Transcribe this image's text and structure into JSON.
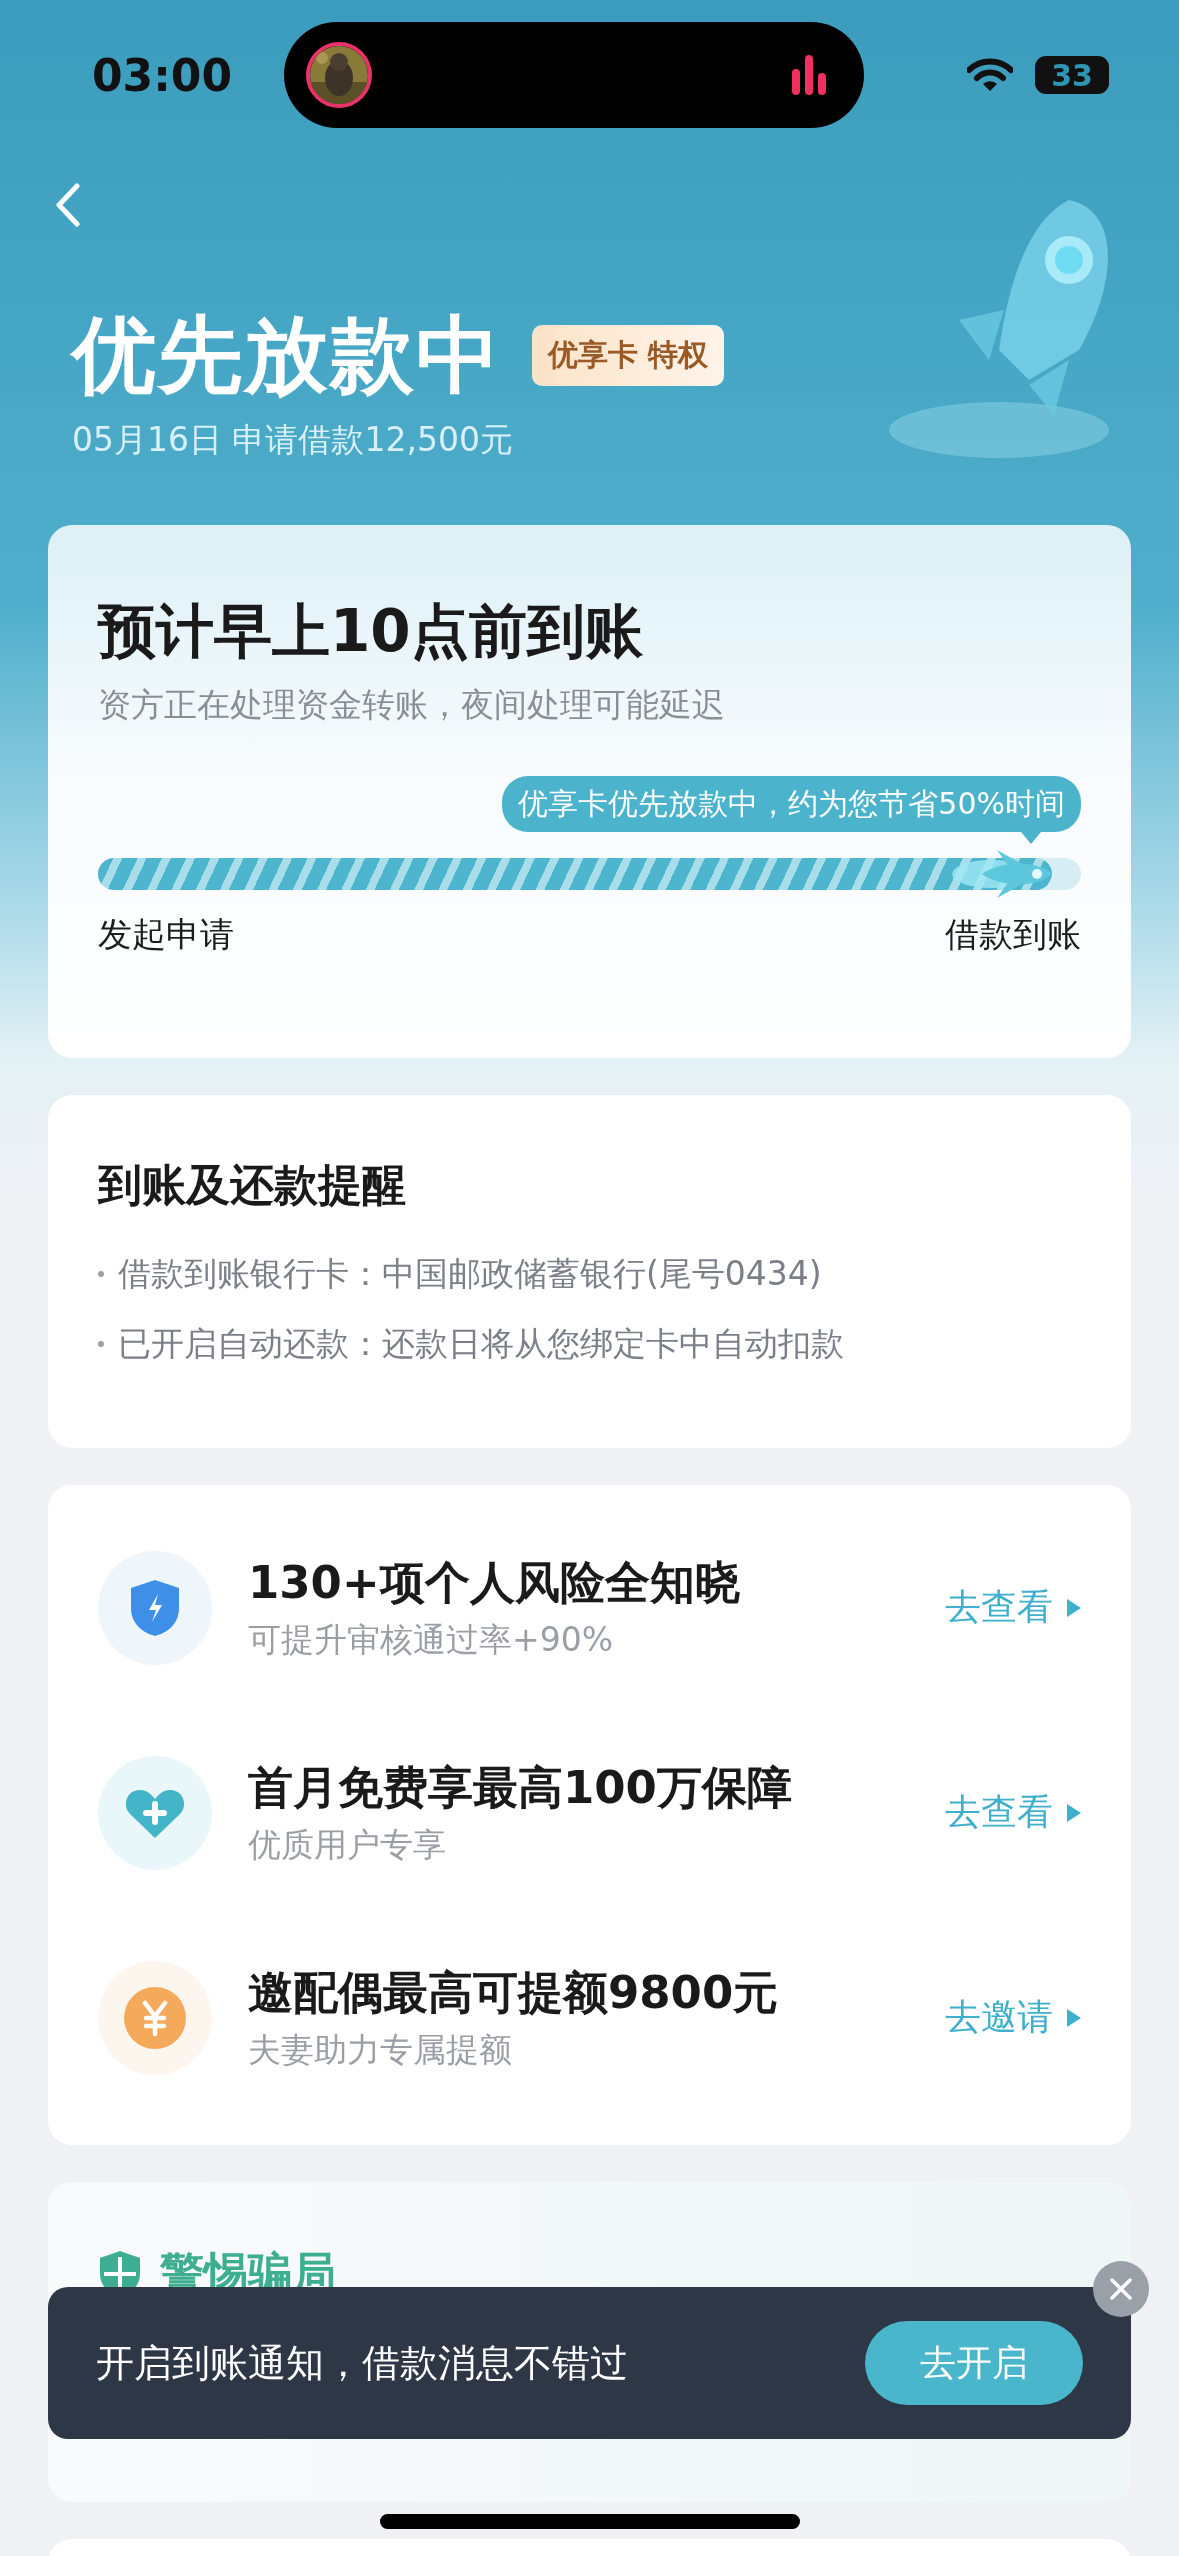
{
  "status_bar": {
    "time": "03:00",
    "battery": "33"
  },
  "header": {
    "title": "优先放款中",
    "badge": "优享卡 特权",
    "subtitle": "05月16日 申请借款12,500元"
  },
  "arrival_card": {
    "title": "预计早上10点前到账",
    "description": "资方正在处理资金转账，夜间处理可能延迟",
    "tooltip": "优享卡优先放款中，约为您节省50%时间",
    "progress": {
      "level": 0.97
    },
    "start_label": "发起申请",
    "end_label": "借款到账"
  },
  "reminder_card": {
    "title": "到账及还款提醒",
    "items": [
      "借款到账银行卡：中国邮政储蓄银行(尾号0434)",
      "已开启自动还款：还款日将从您绑定卡中自动扣款"
    ]
  },
  "offers": [
    {
      "kind": "shield",
      "title": "130+项个人风险全知晓",
      "subtitle": "可提升审核通过率+90%",
      "action": "去查看"
    },
    {
      "kind": "heart",
      "title": "首月免费享最高100万保障",
      "subtitle": "优质用户专享",
      "action": "去查看"
    },
    {
      "kind": "coin",
      "title": "邀配偶最高可提额9800元",
      "subtitle": "夫妻助力专属提额",
      "action": "去邀请"
    }
  ],
  "scam_card": {
    "title": "警惕骗局"
  },
  "toast": {
    "message": "开启到账通知，借款消息不错过",
    "button": "去开启"
  }
}
